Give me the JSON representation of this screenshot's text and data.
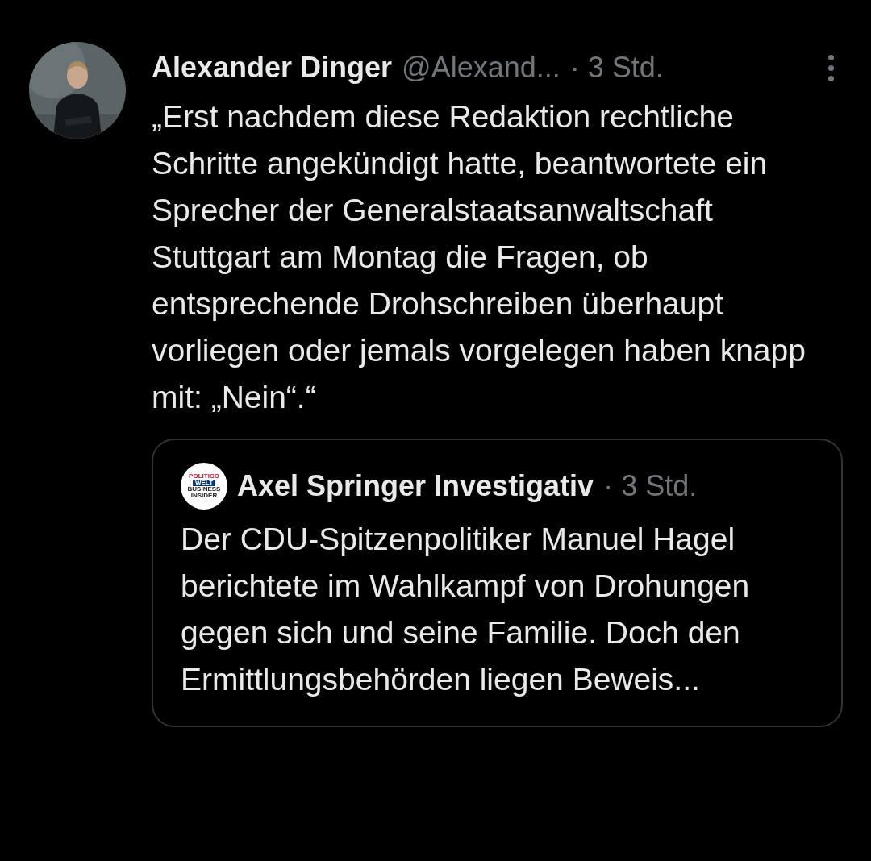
{
  "post": {
    "author": "Alexander Dinger",
    "handle": "@Alexand...",
    "time": "· 3 Std.",
    "text": "„Erst nachdem diese Redaktion rechtliche Schritte angekündigt hatte, beantwortete ein Sprecher der Generalstaatsanwaltschaft Stuttgart am Montag die Fragen, ob entsprechende Drohschreiben überhaupt vorliegen oder jemals vorgelegen haben knapp mit: „Nein“.“"
  },
  "quoted_post": {
    "logo_lines": [
      "POLITICO",
      "WELT",
      "BUSINESS",
      "INSIDER"
    ],
    "author": "Axel Springer Investigativ",
    "time": "· 3 Std.",
    "text": "Der CDU-Spitzenpolitiker Manuel Hagel berichtete im Wahlkampf von Drohungen gegen sich und seine Familie. Doch den Ermittlungsbehörden liegen Beweis..."
  }
}
